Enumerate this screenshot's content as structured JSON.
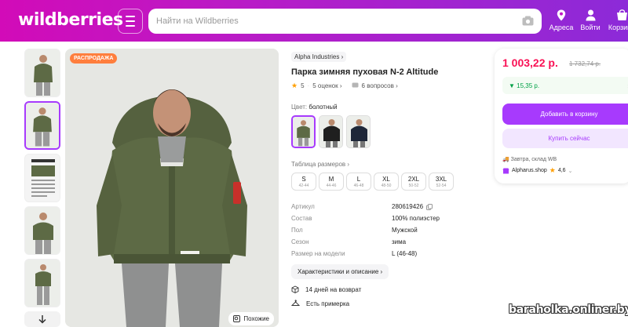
{
  "header": {
    "logo": "wildberries",
    "search_placeholder": "Найти на Wildberries",
    "nav": [
      {
        "label": "Адреса",
        "icon": "location-pin-icon"
      },
      {
        "label": "Войти",
        "icon": "user-icon"
      },
      {
        "label": "Корзина",
        "icon": "cart-icon"
      }
    ]
  },
  "gallery": {
    "sale_badge": "РАСПРОДАЖА",
    "similar_label": "Похожие"
  },
  "product": {
    "brand": "Alpha Industries",
    "title": "Парка зимняя пуховая N-2 Altitude",
    "rating": "5",
    "reviews": "5 оценок",
    "questions": "6 вопросов",
    "color_label": "Цвет:",
    "color_value": "болотный",
    "size_table_label": "Таблица размеров",
    "sizes": [
      {
        "size": "S",
        "range": "42-44"
      },
      {
        "size": "M",
        "range": "44-46"
      },
      {
        "size": "L",
        "range": "46-48"
      },
      {
        "size": "XL",
        "range": "48-50"
      },
      {
        "size": "2XL",
        "range": "50-52"
      },
      {
        "size": "3XL",
        "range": "52-54"
      }
    ],
    "specs": [
      {
        "key": "Артикул",
        "value": "280619426"
      },
      {
        "key": "Состав",
        "value": "100% полиэстер"
      },
      {
        "key": "Пол",
        "value": "Мужской"
      },
      {
        "key": "Сезон",
        "value": "зима"
      },
      {
        "key": "Размер на модели",
        "value": "L (46-48)"
      }
    ],
    "chars_button": "Характеристики и описание",
    "features": [
      "14 дней на возврат",
      "Есть примерка"
    ]
  },
  "buy": {
    "price": "1 003,22 р.",
    "old_price": "1 732,74 р.",
    "promo": "15,35 р.",
    "cart_button": "Добавить в корзину",
    "buy_now_button": "Купить сейчас",
    "shipping": "Завтра, склад WB",
    "seller": "Alpharus.shop",
    "seller_rating": "4,6"
  },
  "colors": {
    "brand_pink": "#d20bb8",
    "brand_purple": "#a73afd",
    "price_red": "#f91155",
    "sale_orange": "#ff7e3d",
    "jacket_green": "#5d6a45"
  },
  "watermark": "baraholka.onliner.by"
}
